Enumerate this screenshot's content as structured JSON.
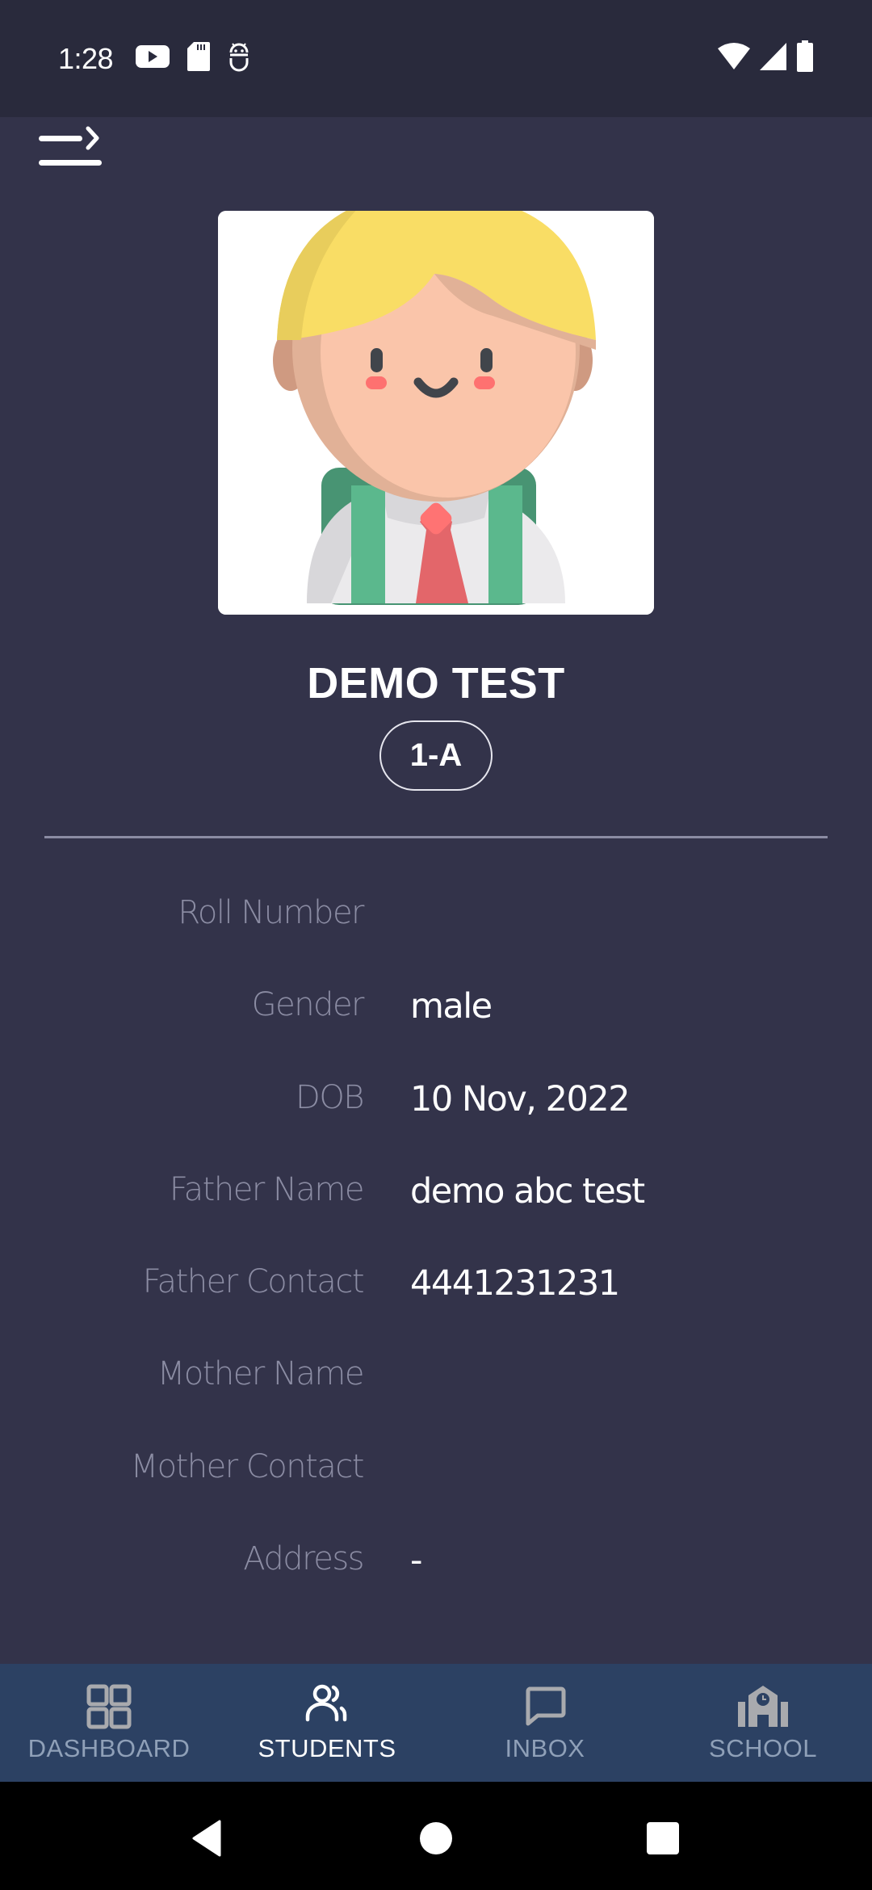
{
  "status_bar": {
    "time": "1:28",
    "left_icons": [
      "youtube-icon",
      "sd-card-icon",
      "android-debug-icon"
    ],
    "right_icons": [
      "wifi-icon",
      "signal-icon",
      "battery-icon"
    ]
  },
  "header": {
    "menu_icon": "menu-open-icon"
  },
  "profile": {
    "avatar_description": "student-avatar",
    "name": "DEMO TEST",
    "class": "1-A"
  },
  "details": [
    {
      "label": "Roll Number",
      "value": ""
    },
    {
      "label": "Gender",
      "value": "male"
    },
    {
      "label": "DOB",
      "value": "10 Nov, 2022"
    },
    {
      "label": "Father Name",
      "value": "demo abc test"
    },
    {
      "label": "Father Contact",
      "value": "4441231231"
    },
    {
      "label": "Mother Name",
      "value": ""
    },
    {
      "label": "Mother Contact",
      "value": ""
    },
    {
      "label": "Address",
      "value": "-"
    }
  ],
  "bottom_nav": {
    "items": [
      {
        "label": "DASHBOARD",
        "icon": "grid-icon",
        "active": false
      },
      {
        "label": "STUDENTS",
        "icon": "users-icon",
        "active": true
      },
      {
        "label": "INBOX",
        "icon": "chat-icon",
        "active": false
      },
      {
        "label": "SCHOOL",
        "icon": "school-icon",
        "active": false
      }
    ]
  },
  "colors": {
    "background": "#33334a",
    "status_bar": "#292a3c",
    "bottom_nav": "#2c4163",
    "label_muted": "#8b8ca3",
    "nav_inactive": "#8fa0b8"
  }
}
